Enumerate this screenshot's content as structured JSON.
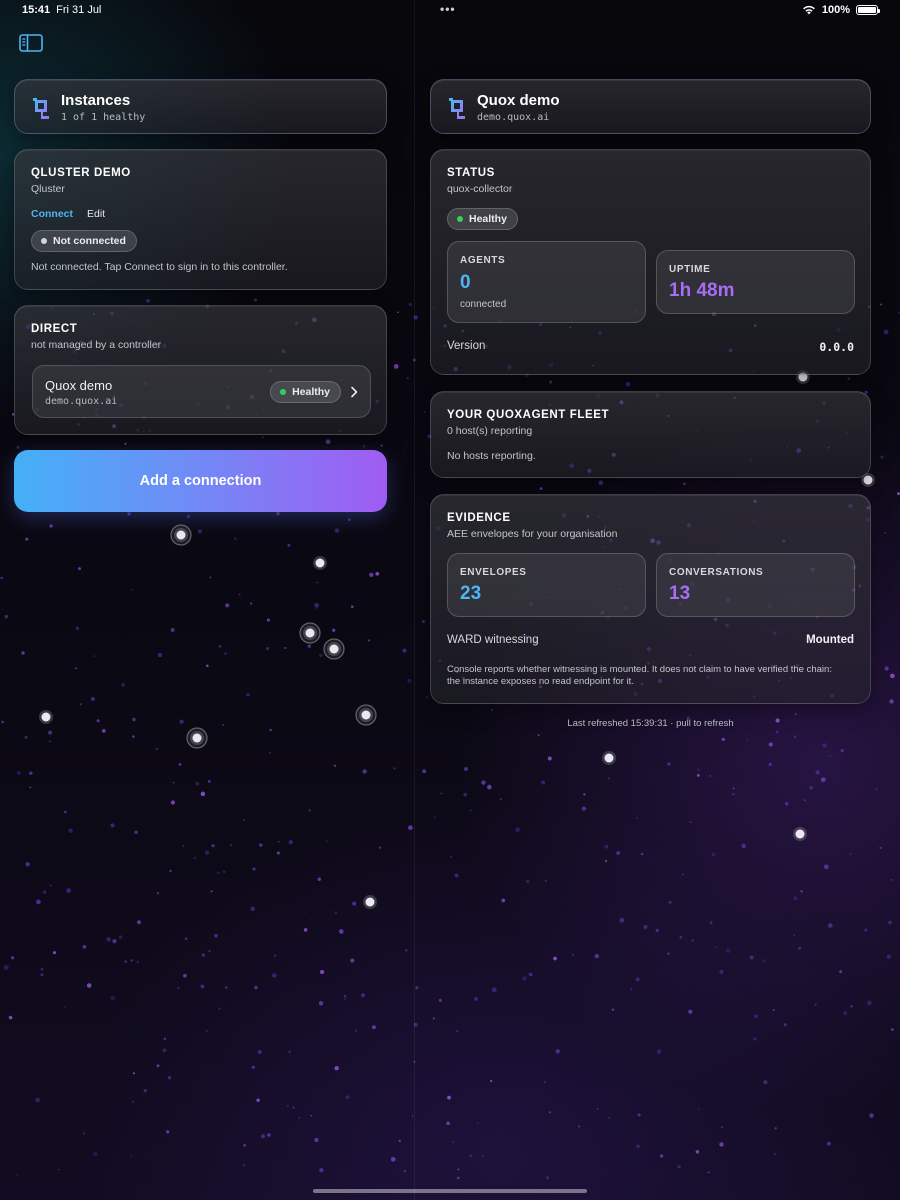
{
  "status_bar": {
    "time": "15:41",
    "date": "Fri 31 Jul",
    "battery": "100%"
  },
  "icons": {
    "sidebar_toggle": "sidebar-toggle-icon",
    "app_logo": "q-logo-icon",
    "wifi": "wifi-icon",
    "battery": "battery-icon",
    "chevron": "chevron-right-icon"
  },
  "colors": {
    "accent_blue": "#4fb4f2",
    "accent_purple": "#a96cf5",
    "healthy_green": "#34d15a",
    "button_gradient_start": "#44b0f7",
    "button_gradient_end": "#a05cf2"
  },
  "sidebar": {
    "header": {
      "title": "Instances",
      "subtitle": "1 of 1 healthy"
    },
    "qluster": {
      "title": "QLUSTER DEMO",
      "subtitle": "Qluster",
      "connect_label": "Connect",
      "edit_label": "Edit",
      "status_pill": "Not connected",
      "message": "Not connected. Tap Connect to sign in to this controller."
    },
    "direct": {
      "title": "DIRECT",
      "subtitle": "not managed by a controller",
      "instance": {
        "name": "Quox demo",
        "host": "demo.quox.ai",
        "status": "Healthy"
      }
    },
    "add_button": "Add a connection"
  },
  "detail": {
    "header": {
      "title": "Quox demo",
      "subtitle": "demo.quox.ai"
    },
    "status": {
      "title": "STATUS",
      "subtitle": "quox-collector",
      "pill": "Healthy",
      "agents": {
        "label": "AGENTS",
        "value": "0",
        "sub": "connected"
      },
      "uptime": {
        "label": "UPTIME",
        "value": "1h 48m"
      },
      "version_label": "Version",
      "version_value": "0.0.0"
    },
    "fleet": {
      "title": "YOUR QUOXAGENT FLEET",
      "subtitle": "0 host(s) reporting",
      "message": "No hosts reporting."
    },
    "evidence": {
      "title": "EVIDENCE",
      "subtitle": "AEE envelopes for your organisation",
      "envelopes": {
        "label": "ENVELOPES",
        "value": "23"
      },
      "conversations": {
        "label": "CONVERSATIONS",
        "value": "13"
      },
      "ward_label": "WARD witnessing",
      "ward_value": "Mounted",
      "note": "Console reports whether witnessing is mounted. It does not claim to have verified the chain: the instance exposes no read endpoint for it."
    },
    "footer": "Last refreshed 15:39:31 · pull to refresh"
  }
}
